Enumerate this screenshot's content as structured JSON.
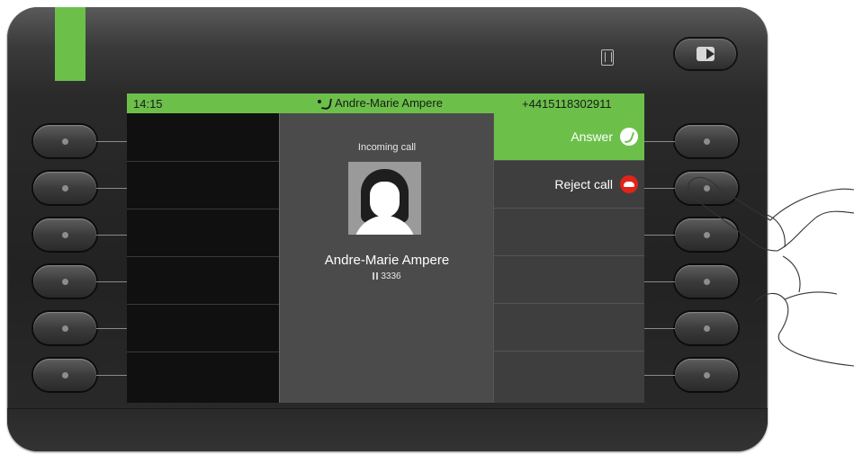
{
  "status_bar": {
    "time": "14:15",
    "caller_name": "Andre-Marie Ampere",
    "caller_number": "+4415118302911"
  },
  "call": {
    "incoming_label": "Incoming call",
    "caller_name": "Andre-Marie Ampere",
    "extension": "3336"
  },
  "actions": [
    {
      "label": "Answer",
      "icon": "answer-phone-icon",
      "active": true
    },
    {
      "label": "Reject call",
      "icon": "reject-phone-icon",
      "active": false
    }
  ],
  "colors": {
    "accent": "#6cc04a",
    "reject": "#e2231a",
    "screen_bg": "#4a4a4a"
  }
}
